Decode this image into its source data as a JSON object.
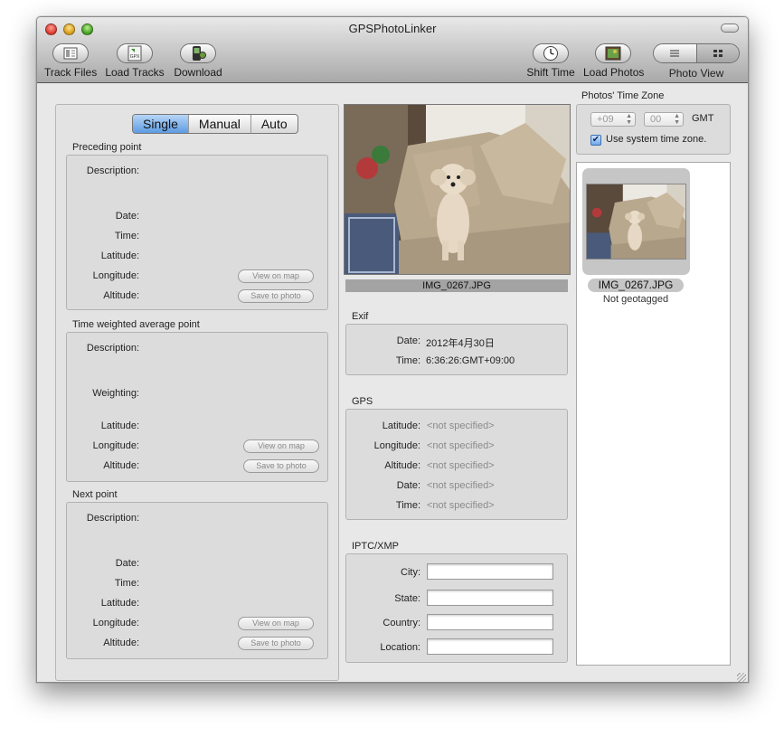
{
  "window": {
    "title": "GPSPhotoLinker"
  },
  "toolbar": {
    "track_files": "Track Files",
    "load_tracks": "Load Tracks",
    "download": "Download",
    "shift_time": "Shift Time",
    "load_photos": "Load Photos",
    "photo_view": "Photo View",
    "gpx_badge": "GPX"
  },
  "modes": {
    "single": "Single",
    "manual": "Manual",
    "auto": "Auto",
    "selected": "Single"
  },
  "preceding": {
    "title": "Preceding point",
    "description": "Description:",
    "date": "Date:",
    "time": "Time:",
    "latitude": "Latitude:",
    "longitude": "Longitude:",
    "altitude": "Altitude:",
    "view_on_map": "View on map",
    "save_to_photo": "Save to photo"
  },
  "average": {
    "title": "Time weighted average point",
    "description": "Description:",
    "weighting": "Weighting:",
    "latitude": "Latitude:",
    "longitude": "Longitude:",
    "altitude": "Altitude:",
    "view_on_map": "View on map",
    "save_to_photo": "Save to photo"
  },
  "next": {
    "title": "Next point",
    "description": "Description:",
    "date": "Date:",
    "time": "Time:",
    "latitude": "Latitude:",
    "longitude": "Longitude:",
    "altitude": "Altitude:",
    "view_on_map": "View on map",
    "save_to_photo": "Save to photo"
  },
  "photo": {
    "filename": "IMG_0267.JPG"
  },
  "exif": {
    "title": "Exif",
    "date_label": "Date:",
    "date_value": "2012年4月30日",
    "time_label": "Time:",
    "time_value": "6:36:26:GMT+09:00"
  },
  "gps": {
    "title": "GPS",
    "latitude_label": "Latitude:",
    "longitude_label": "Longitude:",
    "altitude_label": "Altitude:",
    "date_label": "Date:",
    "time_label": "Time:",
    "not_specified": "<not specified>"
  },
  "iptc": {
    "title": "IPTC/XMP",
    "city_label": "City:",
    "state_label": "State:",
    "country_label": "Country:",
    "location_label": "Location:",
    "city": "",
    "state": "",
    "country": "",
    "location": ""
  },
  "timezone": {
    "title": "Photos' Time Zone",
    "hours": "+09",
    "minutes": "00",
    "gmt": "GMT",
    "use_system_label": "Use system time zone.",
    "use_system_checked": true
  },
  "browser": {
    "items": [
      {
        "filename": "IMG_0267.JPG",
        "status": "Not geotagged"
      }
    ]
  }
}
